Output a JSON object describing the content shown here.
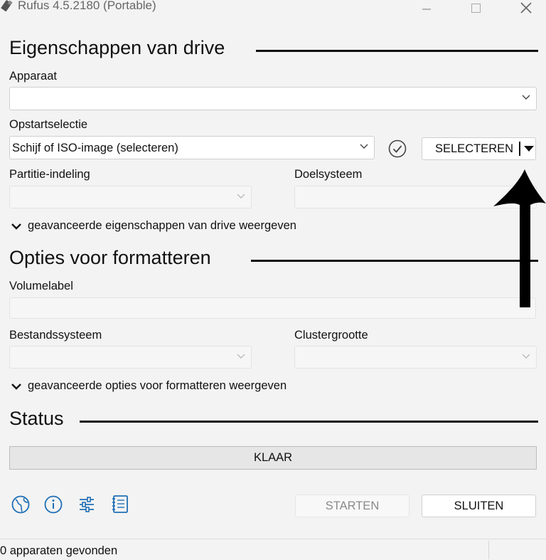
{
  "window": {
    "title": "Rufus 4.5.2180 (Portable)",
    "app_icon": "usb-drive-icon",
    "controls": [
      "minimize-icon",
      "maximize-icon",
      "close-icon"
    ]
  },
  "drive_properties": {
    "heading": "Eigenschappen van drive",
    "device_label": "Apparaat",
    "device_value": "",
    "boot_selection_label": "Opstartselectie",
    "boot_selection_value": "Schijf of ISO-image (selecteren)",
    "select_button": "SELECTEREN",
    "partition_label": "Partitie-indeling",
    "partition_value": "",
    "target_label": "Doelsysteem",
    "target_value": "",
    "advanced_toggle": "geavanceerde eigenschappen van drive weergeven"
  },
  "format_options": {
    "heading": "Opties voor formatteren",
    "volume_label": "Volumelabel",
    "volume_value": "",
    "filesystem_label": "Bestandssysteem",
    "filesystem_value": "",
    "cluster_label": "Clustergrootte",
    "cluster_value": "",
    "advanced_toggle": "geavanceerde opties voor formatteren weergeven"
  },
  "status": {
    "heading": "Status",
    "progress_text": "KLAAR"
  },
  "toolbar": {
    "icons": [
      "globe-icon",
      "info-icon",
      "settings-sliders-icon",
      "log-icon"
    ],
    "start_button": "STARTEN",
    "close_button": "SLUITEN"
  },
  "statusbar": {
    "text": "0 apparaten gevonden"
  },
  "colors": {
    "background": "#f3f3f3",
    "icon_blue": "#1f6fb5",
    "annotation_arrow": "#000000"
  }
}
